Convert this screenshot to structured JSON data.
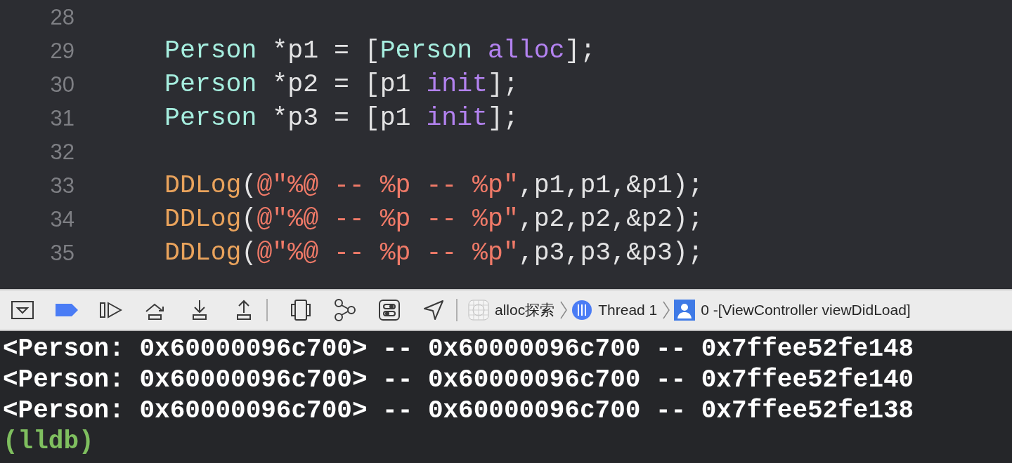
{
  "editor": {
    "lines": [
      {
        "number": "28"
      },
      {
        "number": "29",
        "tokens": [
          {
            "kind": "type",
            "text": "Person"
          },
          {
            "kind": "plain",
            "text": " *p1 = ["
          },
          {
            "kind": "type",
            "text": "Person "
          },
          {
            "kind": "method",
            "text": "alloc"
          },
          {
            "kind": "plain",
            "text": "];"
          }
        ]
      },
      {
        "number": "30",
        "tokens": [
          {
            "kind": "type",
            "text": "Person"
          },
          {
            "kind": "plain",
            "text": " *p2 = [p1 "
          },
          {
            "kind": "method",
            "text": "init"
          },
          {
            "kind": "plain",
            "text": "];"
          }
        ]
      },
      {
        "number": "31",
        "tokens": [
          {
            "kind": "type",
            "text": "Person"
          },
          {
            "kind": "plain",
            "text": " *p3 = [p1 "
          },
          {
            "kind": "method",
            "text": "init"
          },
          {
            "kind": "plain",
            "text": "];"
          }
        ]
      },
      {
        "number": "32"
      },
      {
        "number": "33",
        "tokens": [
          {
            "kind": "func",
            "text": "DDLog"
          },
          {
            "kind": "plain",
            "text": "("
          },
          {
            "kind": "string",
            "text": "@\"%@ -- %p -- %p\""
          },
          {
            "kind": "plain",
            "text": ",p1,p1,&p1);"
          }
        ]
      },
      {
        "number": "34",
        "tokens": [
          {
            "kind": "func",
            "text": "DDLog"
          },
          {
            "kind": "plain",
            "text": "("
          },
          {
            "kind": "string",
            "text": "@\"%@ -- %p -- %p\""
          },
          {
            "kind": "plain",
            "text": ",p2,p2,&p2);"
          }
        ]
      },
      {
        "number": "35",
        "tokens": [
          {
            "kind": "func",
            "text": "DDLog"
          },
          {
            "kind": "plain",
            "text": "("
          },
          {
            "kind": "string",
            "text": "@\"%@ -- %p -- %p\""
          },
          {
            "kind": "plain",
            "text": ",p3,p3,&p3);"
          }
        ]
      }
    ]
  },
  "debug_bar": {
    "breadcrumbs": [
      {
        "kind": "app",
        "label": "alloc探索"
      },
      {
        "kind": "thread",
        "label": "Thread 1"
      },
      {
        "kind": "frame",
        "label": "0 -[ViewController viewDidLoad]"
      }
    ]
  },
  "console": {
    "lines": [
      {
        "kind": "output",
        "text": "<Person: 0x60000096c700> -- 0x60000096c700 -- 0x7ffee52fe148"
      },
      {
        "kind": "output",
        "text": "<Person: 0x60000096c700> -- 0x60000096c700 -- 0x7ffee52fe140"
      },
      {
        "kind": "output",
        "text": "<Person: 0x60000096c700> -- 0x60000096c700 -- 0x7ffee52fe138"
      },
      {
        "kind": "prompt",
        "text": "(lldb)"
      }
    ]
  }
}
